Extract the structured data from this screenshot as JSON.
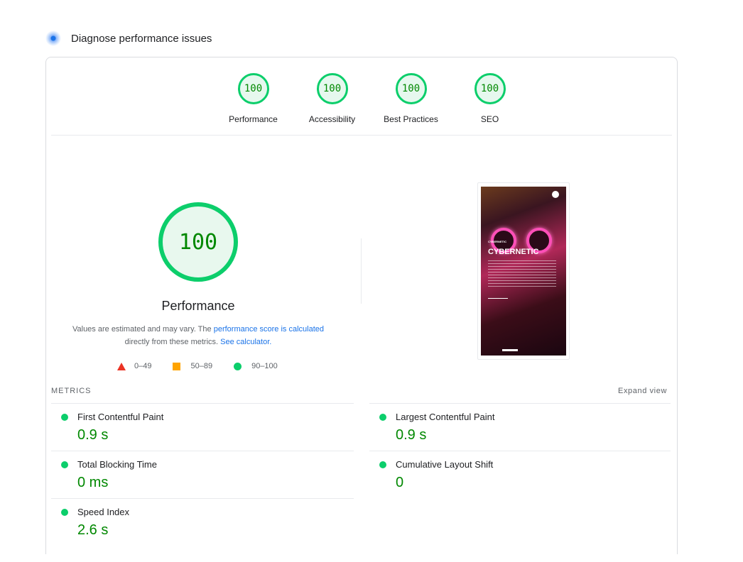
{
  "header": {
    "title": "Diagnose performance issues",
    "icon": "lighthouse-spinner-icon"
  },
  "categories": [
    {
      "score": "100",
      "label": "Performance"
    },
    {
      "score": "100",
      "label": "Accessibility"
    },
    {
      "score": "100",
      "label": "Best Practices"
    },
    {
      "score": "100",
      "label": "SEO"
    }
  ],
  "performance": {
    "score": "100",
    "title": "Performance",
    "note_prefix": "Values are estimated and may vary. The ",
    "note_link1": "performance score is calculated",
    "note_middle": " directly from these metrics. ",
    "note_link2": "See calculator.",
    "legend": [
      {
        "icon": "triangle-icon",
        "range": "0–49",
        "color": "#eb3324"
      },
      {
        "icon": "square-icon",
        "range": "50–89",
        "color": "#ffa400"
      },
      {
        "icon": "circle-icon",
        "range": "90–100",
        "color": "#0cce6b"
      }
    ]
  },
  "screenshot": {
    "small": "CYBERNETIC",
    "headline": "CYBERNETIC"
  },
  "metrics": {
    "heading": "METRICS",
    "expand": "Expand view",
    "items": [
      {
        "name": "First Contentful Paint",
        "value": "0.9 s"
      },
      {
        "name": "Largest Contentful Paint",
        "value": "0.9 s"
      },
      {
        "name": "Total Blocking Time",
        "value": "0 ms"
      },
      {
        "name": "Cumulative Layout Shift",
        "value": "0"
      },
      {
        "name": "Speed Index",
        "value": "2.6 s"
      }
    ]
  },
  "colors": {
    "pass": "#0cce6b",
    "pass_text": "#008800",
    "link": "#1a73e8"
  }
}
